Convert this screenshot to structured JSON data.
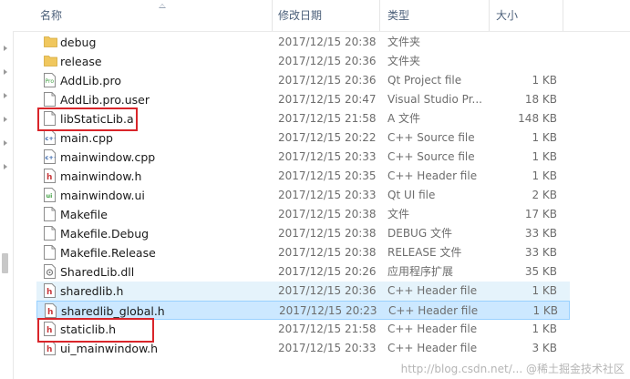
{
  "columns": {
    "name": "名称",
    "date": "修改日期",
    "type": "类型",
    "size": "大小"
  },
  "files": [
    {
      "name": "debug",
      "date": "2017/12/15 20:38",
      "type": "文件夹",
      "size": "",
      "icon": "folder-icon"
    },
    {
      "name": "release",
      "date": "2017/12/15 20:36",
      "type": "文件夹",
      "size": "",
      "icon": "folder-icon"
    },
    {
      "name": "AddLib.pro",
      "date": "2017/12/15 20:36",
      "type": "Qt Project file",
      "size": "1 KB",
      "icon": "qt-project-icon"
    },
    {
      "name": "AddLib.pro.user",
      "date": "2017/12/15 20:47",
      "type": "Visual Studio Pr...",
      "size": "18 KB",
      "icon": "document-icon"
    },
    {
      "name": "libStaticLib.a",
      "date": "2017/12/15 21:58",
      "type": "A 文件",
      "size": "148 KB",
      "icon": "document-icon"
    },
    {
      "name": "main.cpp",
      "date": "2017/12/15 20:22",
      "type": "C++ Source file",
      "size": "1 KB",
      "icon": "cpp-file-icon"
    },
    {
      "name": "mainwindow.cpp",
      "date": "2017/12/15 20:33",
      "type": "C++ Source file",
      "size": "1 KB",
      "icon": "cpp-file-icon"
    },
    {
      "name": "mainwindow.h",
      "date": "2017/12/15 20:35",
      "type": "C++ Header file",
      "size": "1 KB",
      "icon": "header-file-icon"
    },
    {
      "name": "mainwindow.ui",
      "date": "2017/12/15 20:33",
      "type": "Qt UI file",
      "size": "2 KB",
      "icon": "qt-ui-file-icon"
    },
    {
      "name": "Makefile",
      "date": "2017/12/15 20:38",
      "type": "文件",
      "size": "17 KB",
      "icon": "document-icon"
    },
    {
      "name": "Makefile.Debug",
      "date": "2017/12/15 20:38",
      "type": "DEBUG 文件",
      "size": "33 KB",
      "icon": "document-icon"
    },
    {
      "name": "Makefile.Release",
      "date": "2017/12/15 20:38",
      "type": "RELEASE 文件",
      "size": "33 KB",
      "icon": "document-icon"
    },
    {
      "name": "SharedLib.dll",
      "date": "2017/12/15 20:26",
      "type": "应用程序扩展",
      "size": "35 KB",
      "icon": "dll-file-icon"
    },
    {
      "name": "sharedlib.h",
      "date": "2017/12/15 20:36",
      "type": "C++ Header file",
      "size": "1 KB",
      "icon": "header-file-icon"
    },
    {
      "name": "sharedlib_global.h",
      "date": "2017/12/15 20:23",
      "type": "C++ Header file",
      "size": "1 KB",
      "icon": "header-file-icon"
    },
    {
      "name": "staticlib.h",
      "date": "2017/12/15 21:58",
      "type": "C++ Header file",
      "size": "1 KB",
      "icon": "header-file-icon"
    },
    {
      "name": "ui_mainwindow.h",
      "date": "2017/12/15 20:33",
      "type": "C++ Header file",
      "size": "3 KB",
      "icon": "header-file-icon"
    }
  ],
  "hovered_row": 13,
  "selected_row": 14,
  "highlighted_rows": [
    4,
    15
  ],
  "watermark": "http://blog.csdn.net/... @稀土掘金技术社区",
  "colors": {
    "highlight": "#d9252a",
    "selection": "#cce8ff",
    "hover": "#e5f3fb",
    "header_text": "#4c607a",
    "folder": "#f0c75e"
  }
}
